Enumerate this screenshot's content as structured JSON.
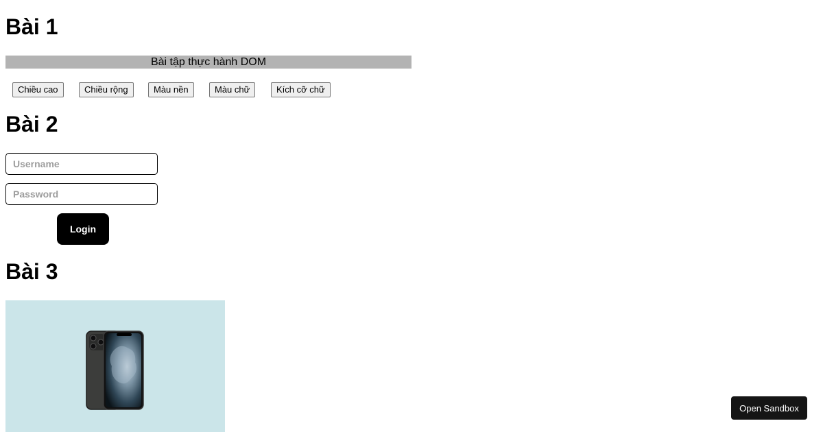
{
  "sections": {
    "bai1": {
      "heading": "Bài 1",
      "banner_text": "Bài tập thực hành DOM",
      "buttons": [
        "Chiều cao",
        "Chiều rộng",
        "Màu nền",
        "Màu chữ",
        "Kích cỡ chữ"
      ]
    },
    "bai2": {
      "heading": "Bài 2",
      "username_placeholder": "Username",
      "password_placeholder": "Password",
      "login_label": "Login"
    },
    "bai3": {
      "heading": "Bài 3",
      "image_alt": "iPhone 11 Pro"
    }
  },
  "sandbox_button": "Open Sandbox",
  "colors": {
    "banner_bg": "#b3b3b3",
    "login_bg": "#000000",
    "image_bg": "#cbe5e9",
    "sandbox_bg": "#151515"
  }
}
